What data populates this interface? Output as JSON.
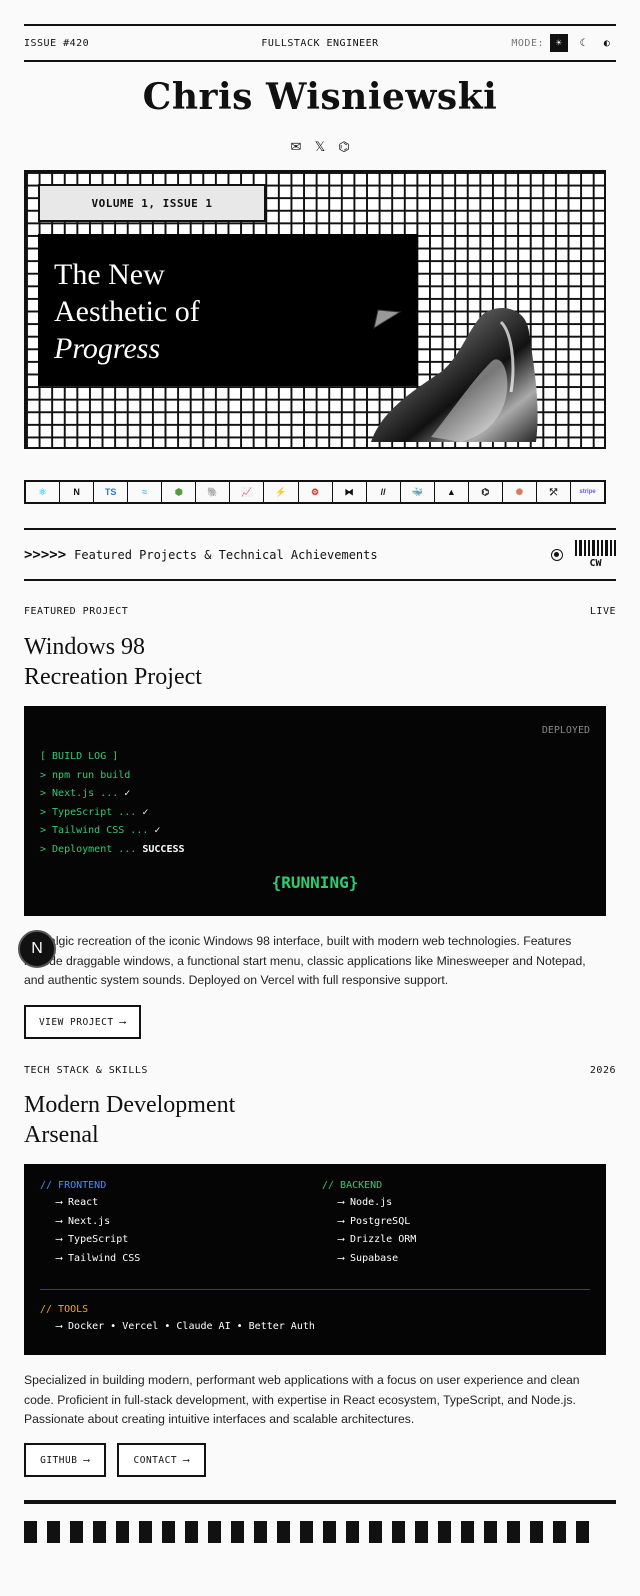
{
  "topbar": {
    "issue": "ISSUE #420",
    "role": "FULLSTACK ENGINEER",
    "mode_label": "MODE:",
    "mode_options": [
      "☀",
      "☾",
      "◐"
    ]
  },
  "header": {
    "name": "Chris Wisniewski"
  },
  "socials": [
    {
      "icon": "mail-icon",
      "glyph": "✉"
    },
    {
      "icon": "x-icon",
      "glyph": "𝕏"
    },
    {
      "icon": "github-icon",
      "glyph": "⌬"
    }
  ],
  "hero": {
    "volume": "VOLUME 1, ISSUE 1",
    "line1": "The New",
    "line2": "Aesthetic of",
    "line3": "Progress"
  },
  "tech_logos": [
    {
      "icon": "react-icon",
      "glyph": "⚛",
      "color": "#61dafb"
    },
    {
      "icon": "nextjs-icon",
      "glyph": "N",
      "color": "#111111"
    },
    {
      "icon": "typescript-icon",
      "glyph": "TS",
      "color": "#3178c6"
    },
    {
      "icon": "tailwind-icon",
      "glyph": "≈",
      "color": "#38bdf8"
    },
    {
      "icon": "nodejs-icon",
      "glyph": "⬢",
      "color": "#539e43"
    },
    {
      "icon": "postgresql-icon",
      "glyph": "🐘",
      "color": "#336791"
    },
    {
      "icon": "chart-icon",
      "glyph": "📈",
      "color": "#111111"
    },
    {
      "icon": "supabase-icon",
      "glyph": "⚡",
      "color": "#3ecf8e"
    },
    {
      "icon": "rust-icon",
      "glyph": "⚙",
      "color": "#c0392b"
    },
    {
      "icon": "sanity-icon",
      "glyph": "⧓",
      "color": "#111111"
    },
    {
      "icon": "slash-icon",
      "glyph": "//",
      "color": "#111111"
    },
    {
      "icon": "docker-icon",
      "glyph": "🐳",
      "color": "#2496ed"
    },
    {
      "icon": "vercel-icon",
      "glyph": "▲",
      "color": "#111111"
    },
    {
      "icon": "github-logo-icon",
      "glyph": "⌬",
      "color": "#111111"
    },
    {
      "icon": "claude-icon",
      "glyph": "✺",
      "color": "#d97757"
    },
    {
      "icon": "railway-icon",
      "glyph": "⤱",
      "color": "#111111"
    },
    {
      "icon": "stripe-icon",
      "glyph": "stripe",
      "color": "#635bff"
    }
  ],
  "banner": {
    "arrows": ">>>>>",
    "text": "Featured Projects & Technical Achievements",
    "barcode_label": "CW"
  },
  "featured": {
    "label": "FEATURED PROJECT",
    "status": "LIVE",
    "title_line1": "Windows 98",
    "title_line2": "Recreation Project",
    "terminal": {
      "deployed": "DEPLOYED",
      "header": "[ BUILD LOG ]",
      "cmd": "> npm run build",
      "steps": [
        {
          "text": "> Next.js ... ",
          "result": "✓"
        },
        {
          "text": "> TypeScript ... ",
          "result": "✓"
        },
        {
          "text": "> Tailwind CSS ... ",
          "result": "✓"
        },
        {
          "text": "> Deployment ... ",
          "result": "SUCCESS"
        }
      ],
      "running": "{RUNNING}"
    },
    "description": "Nostalgic recreation of the iconic Windows 98 interface, built with modern web technologies. Features include draggable windows, a functional start menu, classic applications like Minesweeper and Notepad, and authentic system sounds. Deployed on Vercel with full responsive support.",
    "button": "VIEW PROJECT ⟶"
  },
  "skills": {
    "label": "TECH STACK & SKILLS",
    "year": "2026",
    "title_line1": "Modern Development",
    "title_line2": "Arsenal",
    "frontend": {
      "head": "// FRONTEND",
      "items": [
        "⟶  React",
        "⟶  Next.js",
        "⟶  TypeScript",
        "⟶  Tailwind CSS"
      ]
    },
    "backend": {
      "head": "// BACKEND",
      "items": [
        "⟶  Node.js",
        "⟶  PostgreSQL",
        "⟶  Drizzle ORM",
        "⟶  Supabase"
      ]
    },
    "tools": {
      "head": "// TOOLS",
      "text": "⟶  Docker • Vercel • Claude AI • Better Auth"
    },
    "description": "Specialized in building modern, performant web applications with a focus on user experience and clean code. Proficient in full-stack development, with expertise in React ecosystem, TypeScript, and Node.js. Passionate about creating intuitive interfaces and scalable architectures.",
    "github_button": "GITHUB ⟶",
    "contact_button": "CONTACT ⟶"
  },
  "floating": {
    "avatar": "N"
  },
  "colors": {
    "terminal_green": "#2ecc71",
    "frontend_blue": "#4a8cff",
    "backend_green": "#2ecc71",
    "tools_orange": "#f5a623"
  }
}
